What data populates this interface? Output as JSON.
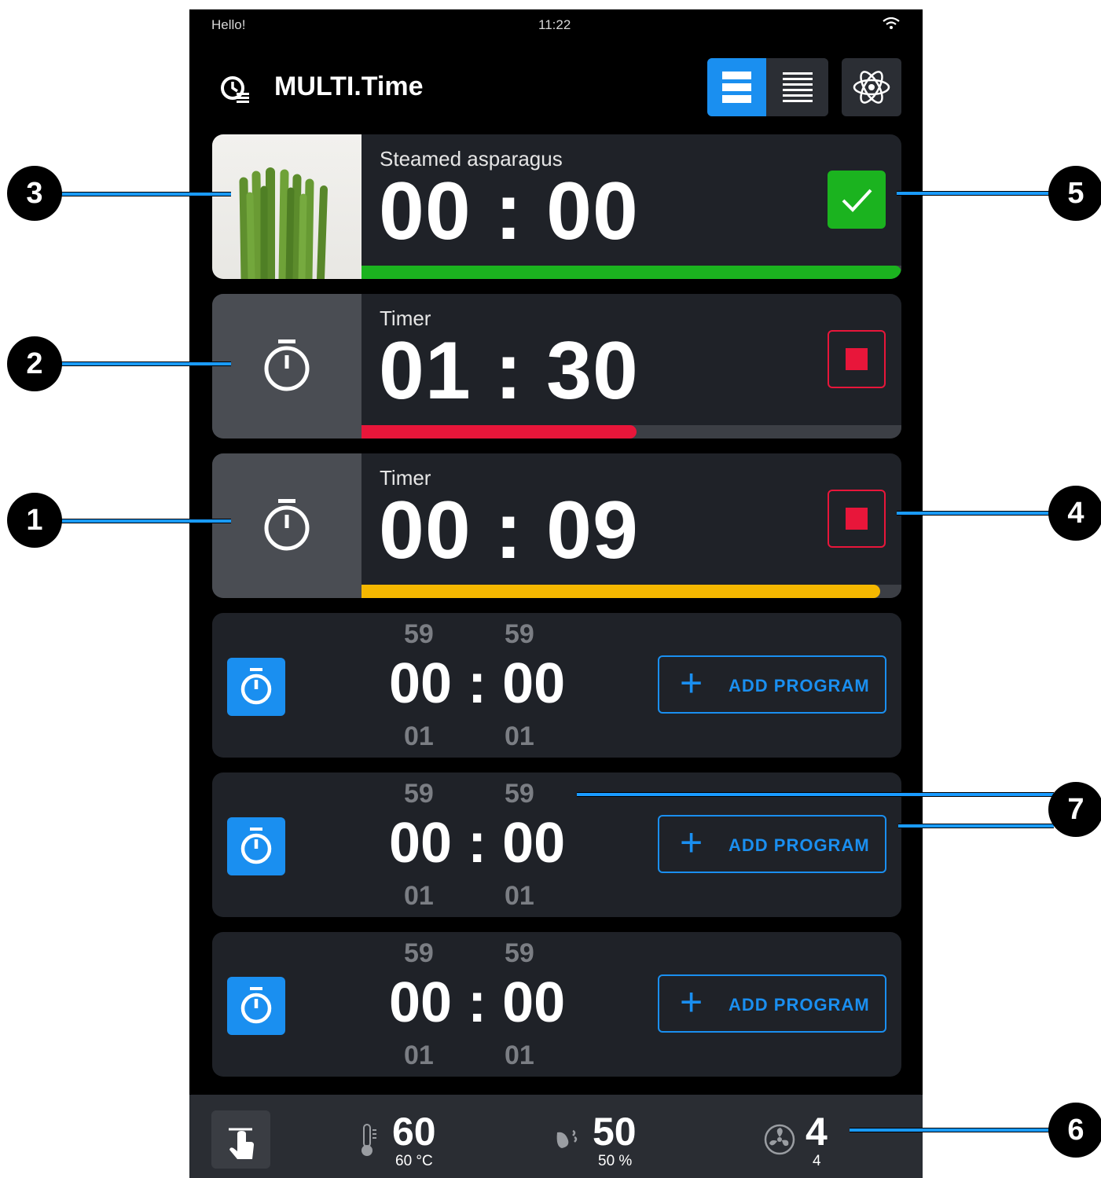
{
  "status_bar": {
    "greeting": "Hello!",
    "time": "11:22"
  },
  "header": {
    "title": "MULTI.Time"
  },
  "cards": [
    {
      "name": "Steamed asparagus",
      "time": "00 : 00",
      "state": "done",
      "progress": 1.0,
      "bar_color": "#1bb31f"
    },
    {
      "name": "Timer",
      "time": "01 : 30",
      "state": "running",
      "progress": 0.51,
      "bar_color": "#e8163a"
    },
    {
      "name": "Timer",
      "time": "00 : 09",
      "state": "running",
      "progress": 0.96,
      "bar_color": "#f5b800"
    }
  ],
  "slots": [
    {
      "above_min": "59",
      "above_sec": "59",
      "time": "00 : 00",
      "below_min": "01",
      "below_sec": "01",
      "button": "ADD PROGRAM"
    },
    {
      "above_min": "59",
      "above_sec": "59",
      "time": "00 : 00",
      "below_min": "01",
      "below_sec": "01",
      "button": "ADD PROGRAM"
    },
    {
      "above_min": "59",
      "above_sec": "59",
      "time": "00 : 00",
      "below_min": "01",
      "below_sec": "01",
      "button": "ADD PROGRAM"
    }
  ],
  "bottom_bar": {
    "temperature": {
      "value": "60",
      "sub": "60 °C"
    },
    "humidity": {
      "value": "50",
      "sub": "50 %"
    },
    "fan": {
      "value": "4",
      "sub": "4"
    }
  },
  "callouts": [
    "1",
    "2",
    "3",
    "4",
    "5",
    "6",
    "7"
  ],
  "colors": {
    "accent": "#1a8ff0",
    "done": "#1bb31f",
    "stop": "#e8163a",
    "warning": "#f5b800"
  }
}
